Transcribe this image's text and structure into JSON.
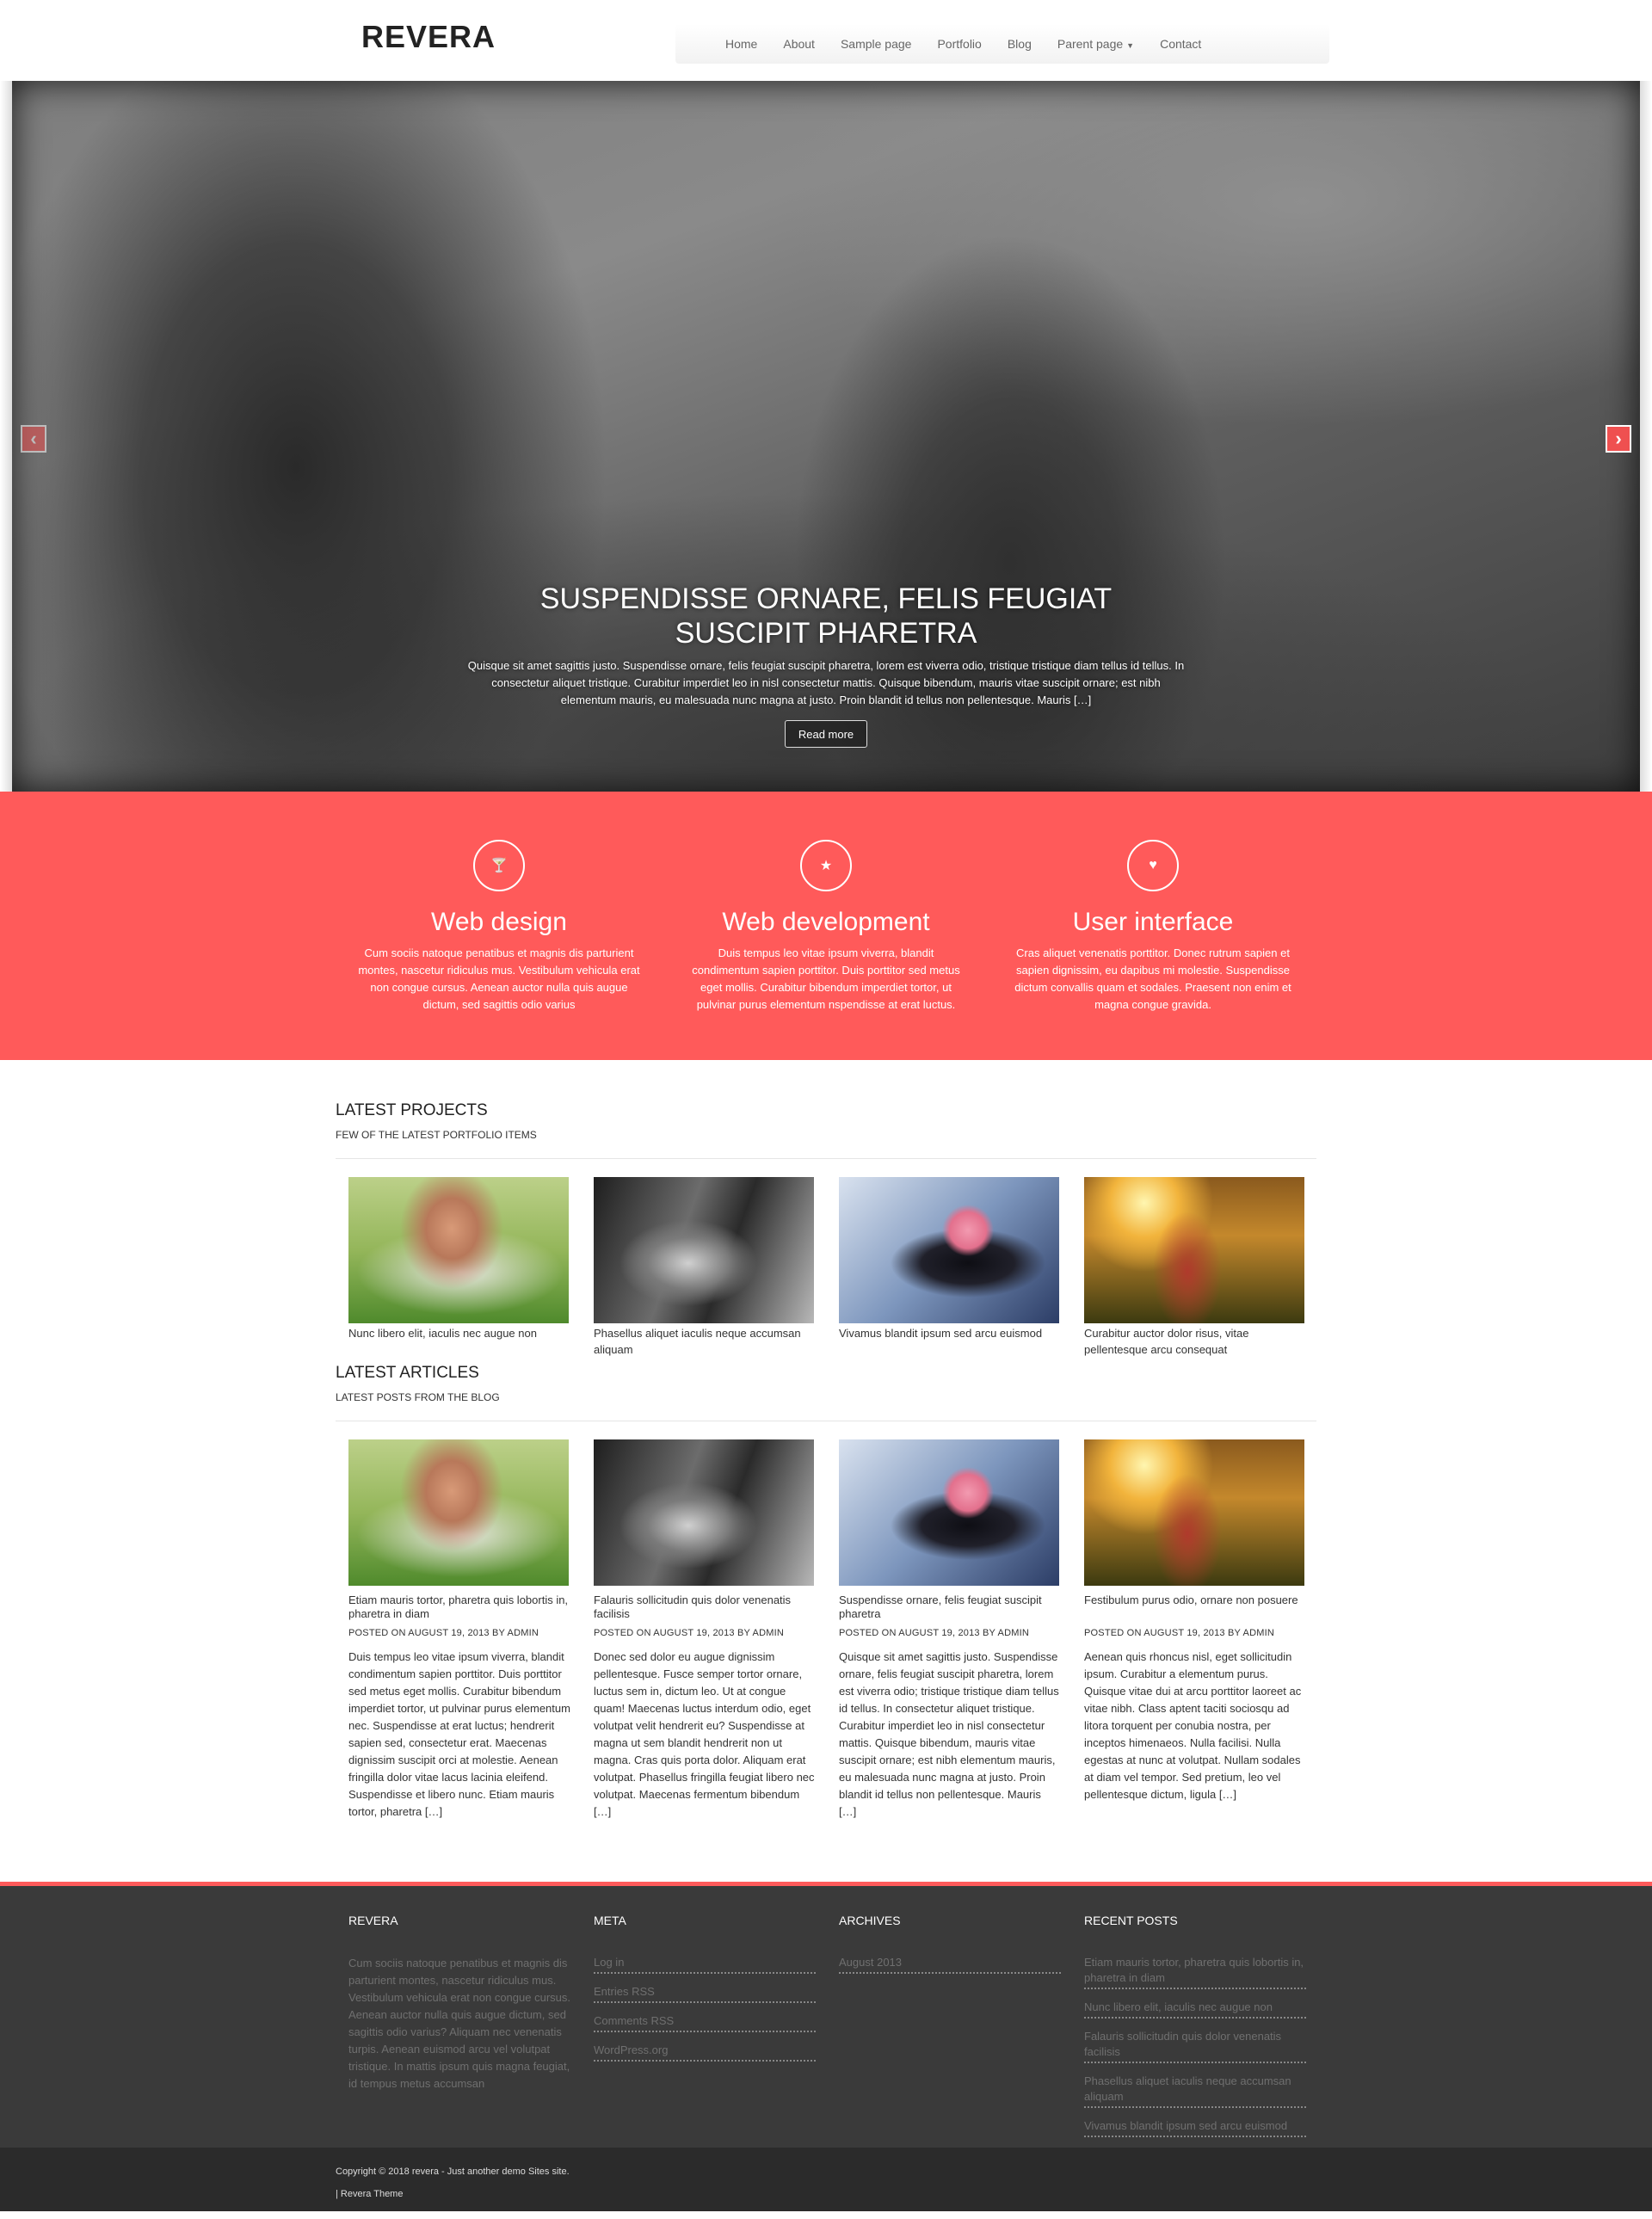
{
  "site": {
    "brand": "REVERA"
  },
  "nav": {
    "items": [
      "Home",
      "About",
      "Sample page",
      "Portfolio",
      "Blog",
      "Parent page",
      "Contact"
    ]
  },
  "hero": {
    "title": "SUSPENDISSE ORNARE, FELIS FEUGIAT SUSCIPIT PHARETRA",
    "text": "Quisque sit amet sagittis justo. Suspendisse ornare, felis feugiat suscipit pharetra, lorem est viverra odio, tristique tristique diam tellus id tellus. In consectetur aliquet tristique. Curabitur imperdiet leo in nisl consectetur mattis. Quisque bibendum, mauris vitae suscipit ornare; est nibh elementum mauris, eu malesuada nunc magna at justo. Proin blandit id tellus non pellentesque. Mauris […]",
    "button": "Read more",
    "prev_icon": "chevron-left-icon",
    "next_icon": "chevron-right-icon"
  },
  "services": [
    {
      "icon": "cocktail-icon",
      "glyph": "🍸",
      "title": "Web design",
      "text": "Cum sociis natoque penatibus et magnis dis parturient montes, nascetur ridiculus mus. Vestibulum vehicula erat non congue cursus. Aenean auctor nulla quis augue dictum, sed sagittis odio varius"
    },
    {
      "icon": "star-icon",
      "glyph": "★",
      "title": "Web development",
      "text": "Duis tempus leo vitae ipsum viverra, blandit condimentum sapien porttitor. Duis porttitor sed metus eget mollis. Curabitur bibendum imperdiet tortor, ut pulvinar purus elementum nspendisse at erat luctus."
    },
    {
      "icon": "heart-icon",
      "glyph": "♥",
      "title": "User interface",
      "text": "Cras aliquet venenatis porttitor. Donec rutrum sapien et sapien dignissim, eu dapibus mi molestie. Suspendisse dictum convallis quam et sodales. Praesent non enim et magna congue gravida."
    }
  ],
  "projects": {
    "title": "LATEST PROJECTS",
    "subtitle": "FEW OF THE LATEST PORTFOLIO ITEMS",
    "items": [
      {
        "caption": "Nunc libero elit, iaculis nec augue non"
      },
      {
        "caption": "Phasellus aliquet iaculis neque accumsan aliquam"
      },
      {
        "caption": "Vivamus blandit ipsum sed arcu euismod"
      },
      {
        "caption": "Curabitur auctor dolor risus, vitae pellentesque arcu consequat"
      }
    ]
  },
  "articles": {
    "title": "LATEST ARTICLES",
    "subtitle": "LATEST POSTS FROM THE BLOG",
    "items": [
      {
        "title": "Etiam mauris tortor, pharetra quis lobortis in, pharetra in diam",
        "meta": "POSTED ON AUGUST 19, 2013 BY ADMIN",
        "excerpt": "Duis tempus leo vitae ipsum viverra, blandit condimentum sapien porttitor. Duis porttitor sed metus eget mollis. Curabitur bibendum imperdiet tortor, ut pulvinar purus elementum nec. Suspendisse at erat luctus; hendrerit sapien sed, consectetur erat. Maecenas dignissim suscipit orci at molestie. Aenean fringilla dolor vitae lacus lacinia eleifend. Suspendisse et libero nunc. Etiam mauris tortor, pharetra […]"
      },
      {
        "title": "Falauris sollicitudin quis dolor venenatis facilisis",
        "meta": "POSTED ON AUGUST 19, 2013 BY ADMIN",
        "excerpt": "Donec sed dolor eu augue dignissim pellentesque. Fusce semper tortor ornare, luctus sem in, dictum leo. Ut at congue quam! Maecenas luctus interdum odio, eget volutpat velit hendrerit eu? Suspendisse at magna ut sem blandit hendrerit non ut magna. Cras quis porta dolor. Aliquam erat volutpat. Phasellus fringilla feugiat libero nec volutpat. Maecenas fermentum bibendum […]"
      },
      {
        "title": "Suspendisse ornare, felis feugiat suscipit pharetra",
        "meta": "POSTED ON AUGUST 19, 2013 BY ADMIN",
        "excerpt": "Quisque sit amet sagittis justo. Suspendisse ornare, felis feugiat suscipit pharetra, lorem est viverra odio; tristique tristique diam tellus id tellus. In consectetur aliquet tristique. Curabitur imperdiet leo in nisl consectetur mattis. Quisque bibendum, mauris vitae suscipit ornare; est nibh elementum mauris, eu malesuada nunc magna at justo. Proin blandit id tellus non pellentesque. Mauris […]"
      },
      {
        "title": "Festibulum purus odio, ornare non posuere",
        "meta": "POSTED ON AUGUST 19, 2013 BY ADMIN",
        "excerpt": "Aenean quis rhoncus nisl, eget sollicitudin ipsum. Curabitur a elementum purus. Quisque vitae dui at arcu porttitor laoreet ac vitae nibh. Class aptent taciti sociosqu ad litora torquent per conubia nostra, per inceptos himenaeos. Nulla facilisi. Nulla egestas at nunc at volutpat. Nullam sodales at diam vel tempor. Sed pretium, leo vel pellentesque dictum, ligula […]"
      }
    ]
  },
  "footer": {
    "about": {
      "title": "REVERA",
      "text": "Cum sociis natoque penatibus et magnis dis parturient montes, nascetur ridiculus mus. Vestibulum vehicula erat non congue cursus. Aenean auctor nulla quis augue dictum, sed sagittis odio varius? Aliquam nec venenatis turpis. Aenean euismod arcu vel volutpat tristique. In mattis ipsum quis magna feugiat, id tempus metus accumsan"
    },
    "meta": {
      "title": "META",
      "links": [
        "Log in",
        "Entries RSS",
        "Comments RSS",
        "WordPress.org"
      ]
    },
    "archives": {
      "title": "ARCHIVES",
      "links": [
        "August 2013"
      ]
    },
    "recent": {
      "title": "RECENT POSTS",
      "links": [
        "Etiam mauris tortor, pharetra quis lobortis in, pharetra in diam",
        "Nunc libero elit, iaculis nec augue non",
        "Falauris sollicitudin quis dolor venenatis facilisis",
        "Phasellus aliquet iaculis neque accumsan aliquam",
        "Vivamus blandit ipsum sed arcu euismod"
      ]
    },
    "copyright": "Copyright © 2018 revera - Just another demo Sites site.",
    "theme": "| Revera Theme"
  },
  "colors": {
    "accent": "#ff5a5a",
    "footer_bg": "#3a3a3a",
    "footer_bottom_bg": "#2b2b2b"
  }
}
